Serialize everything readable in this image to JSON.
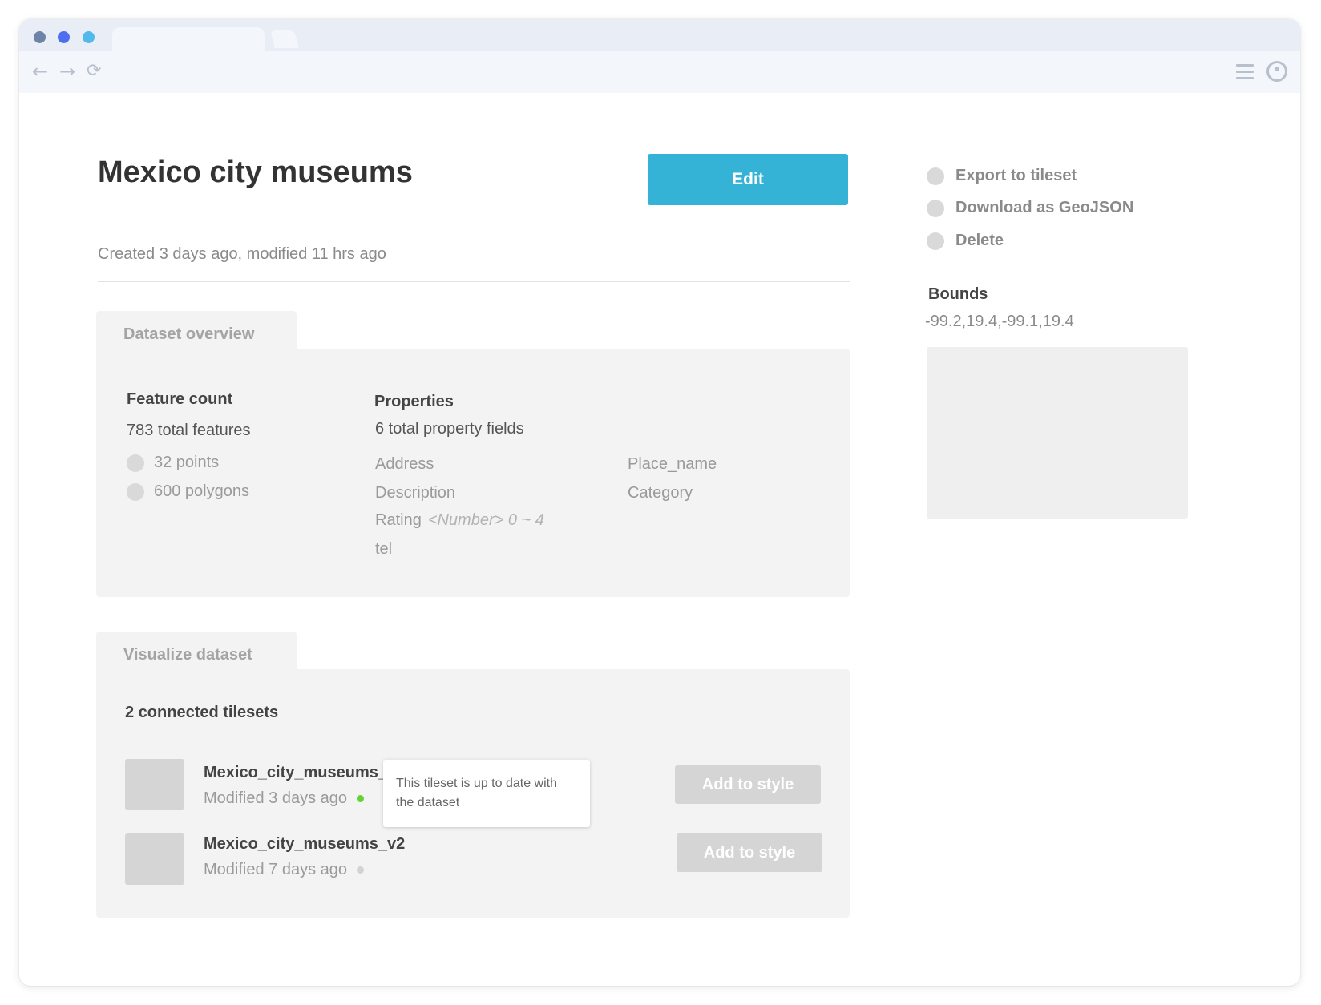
{
  "browser": {
    "nav": {
      "back_icon": "←",
      "forward_icon": "→",
      "reload_icon": "⟳"
    }
  },
  "page": {
    "title": "Mexico city museums",
    "edit_label": "Edit",
    "meta": "Created 3 days ago, modified 11 hrs ago"
  },
  "overview": {
    "tab_label": "Dataset overview",
    "feature_count": {
      "heading": "Feature count",
      "total": "783 total features",
      "items": [
        "32 points",
        "600 polygons"
      ]
    },
    "properties": {
      "heading": "Properties",
      "total": "6 total property fields",
      "col1": [
        "Address",
        "Description",
        "Rating",
        "tel"
      ],
      "col2": [
        "Place_name",
        "Category"
      ],
      "rating_hint": "<Number> 0 ~ 4"
    }
  },
  "visualize": {
    "tab_label": "Visualize dataset",
    "connected": "2 connected tilesets",
    "tilesets": [
      {
        "name": "Mexico_city_museums_",
        "modified": "Modified 3 days ago",
        "status_color": "#64d230",
        "add_label": "Add to style"
      },
      {
        "name": "Mexico_city_museums_v2",
        "modified": "Modified 7 days ago",
        "status_color": "#d2d2d2",
        "add_label": "Add to style"
      }
    ],
    "tooltip": "This tileset is up to date with the dataset"
  },
  "sidebar": {
    "actions": [
      "Export to tileset",
      "Download as GeoJSON",
      "Delete"
    ],
    "bounds_label": "Bounds",
    "bounds_value": "-99.2,19.4,-99.1,19.4"
  },
  "colors": {
    "accent": "#35b3d6",
    "status_ok": "#64d230"
  }
}
